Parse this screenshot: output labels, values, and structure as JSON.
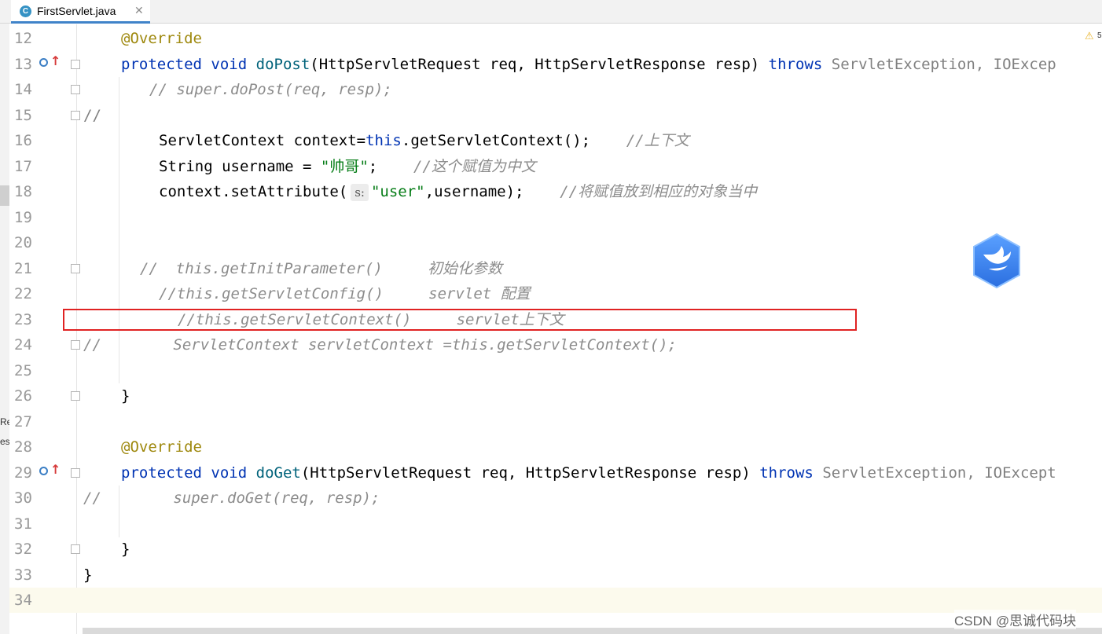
{
  "tab": {
    "icon": "C",
    "name": "FirstServlet.java",
    "close": "✕"
  },
  "warning": {
    "glyph": "⚠",
    "count": "5"
  },
  "left_panel": {
    "frag1": "Re",
    "frag2": "es"
  },
  "code_lines": [
    {
      "num": "12"
    },
    {
      "num": "13"
    },
    {
      "num": "14"
    },
    {
      "num": "15"
    },
    {
      "num": "16"
    },
    {
      "num": "17"
    },
    {
      "num": "18"
    },
    {
      "num": "19"
    },
    {
      "num": "20"
    },
    {
      "num": "21"
    },
    {
      "num": "22"
    },
    {
      "num": "23"
    },
    {
      "num": "24"
    },
    {
      "num": "25"
    },
    {
      "num": "26"
    },
    {
      "num": "27"
    },
    {
      "num": "28"
    },
    {
      "num": "29"
    },
    {
      "num": "30"
    },
    {
      "num": "31"
    },
    {
      "num": "32"
    },
    {
      "num": "33"
    },
    {
      "num": "34"
    }
  ],
  "code": {
    "l12_ann": "@Override",
    "l13_kw1": "protected",
    "l13_kw2": "void",
    "l13_fn": "doPost",
    "l13_params": "(HttpServletRequest req, HttpServletResponse resp) ",
    "l13_throws": "throws",
    "l13_exc": "ServletException, IOExcep",
    "l14_cm": "// super.doPost(req, resp);",
    "l15_cm": "//",
    "l16_a": "ServletContext context=",
    "l16_this": "this",
    "l16_b": ".getServletContext();",
    "l16_cm": "//上下文",
    "l17_a": "String username = ",
    "l17_str": "\"帅哥\"",
    "l17_b": ";",
    "l17_cm": "//这个赋值为中文",
    "l18_a": "context.setAttribute(",
    "l18_hint": "s:",
    "l18_str": "\"user\"",
    "l18_b": ",username);",
    "l18_cm": "//将赋值放到相应的对象当中",
    "l21_cm": "//  this.getInitParameter()     初始化参数",
    "l22_cm": "//this.getServletConfig()     servlet 配置",
    "l23_cm": "//this.getServletContext()     servlet上下文",
    "l24_cm": "//        ServletContext servletContext =this.getServletContext();",
    "l26_brace": "}",
    "l28_ann": "@Override",
    "l29_kw1": "protected",
    "l29_kw2": "void",
    "l29_fn": "doGet",
    "l29_params": "(HttpServletRequest req, HttpServletResponse resp) ",
    "l29_throws": "throws",
    "l29_exc": "ServletException, IOExcept",
    "l30_cm": "//        super.doGet(req, resp);",
    "l32_brace": "}",
    "l33_brace": "}"
  },
  "watermark": "CSDN @思诚代码块",
  "colors": {
    "keyword": "#0033b3",
    "annotation": "#9e880d",
    "method": "#00627a",
    "string": "#067d17",
    "comment": "#8c8c8c",
    "highlight_border": "#e02222",
    "current_line": "#fcfaed"
  }
}
